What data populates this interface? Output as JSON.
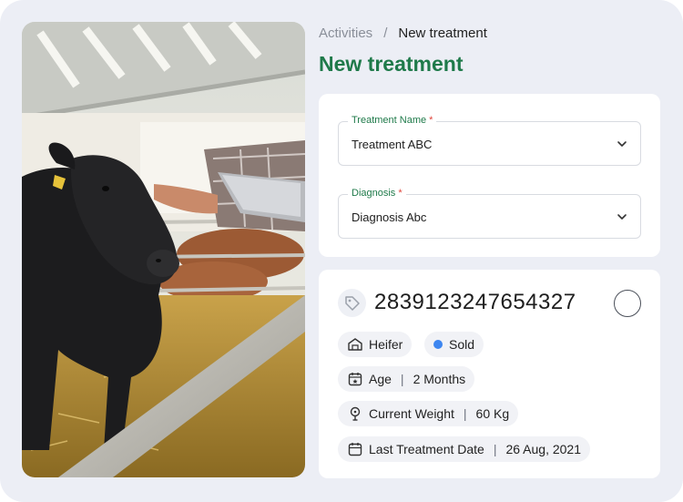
{
  "breadcrumb": {
    "parent": "Activities",
    "separator": "/",
    "current": "New treatment"
  },
  "page": {
    "title": "New treatment"
  },
  "form": {
    "treatment_name": {
      "label": "Treatment Name",
      "required_marker": "*",
      "value": "Treatment ABC"
    },
    "diagnosis": {
      "label": "Diagnosis",
      "required_marker": "*",
      "value": "Diagnosis Abc"
    }
  },
  "animal": {
    "id": "2839123247654327",
    "type": "Heifer",
    "status": "Sold",
    "status_color": "#3d86f0",
    "age_label": "Age",
    "age_value": "2 Months",
    "weight_label": "Current Weight",
    "weight_value": "60 Kg",
    "last_treatment_label": "Last Treatment Date",
    "last_treatment_value": "26 Aug, 2021",
    "divider": "|"
  },
  "colors": {
    "accent": "#1f7a4a",
    "required": "#e0443a",
    "frame_bg": "#eceef5"
  }
}
